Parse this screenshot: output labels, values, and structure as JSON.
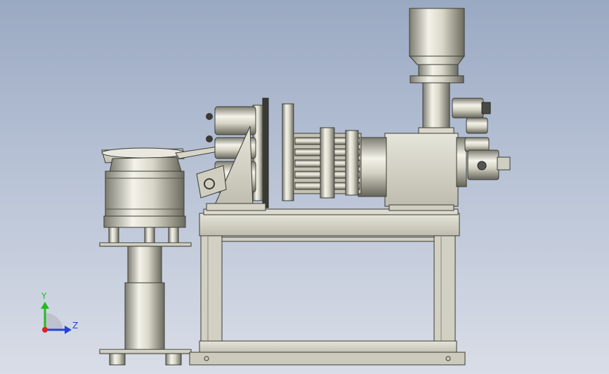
{
  "triad": {
    "y_label": "Y",
    "z_label": "Z",
    "y_color": "#22bb22",
    "z_color": "#2244dd",
    "origin_color": "#dd2222"
  },
  "colors": {
    "metal_light": "#f2f1e6",
    "metal_mid": "#c9c8b6",
    "metal_dark": "#6f6e62",
    "frame": "#d4d3c6",
    "edge": "#3c3c36"
  }
}
